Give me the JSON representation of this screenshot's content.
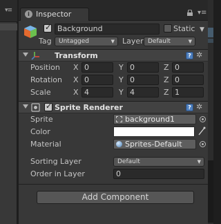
{
  "inspector": {
    "tab_label": "Inspector",
    "icons": [
      "info-icon",
      "lock-icon",
      "menu-icon"
    ]
  },
  "gameobject": {
    "active": true,
    "name": "Background",
    "static_label": "Static",
    "static_checked": false,
    "tag_label": "Tag",
    "tag_value": "Untagged",
    "layer_label": "Layer",
    "layer_value": "Default"
  },
  "transform": {
    "title": "Transform",
    "rows": [
      {
        "label": "Position",
        "x": "0",
        "y": "0",
        "z": "0"
      },
      {
        "label": "Rotation",
        "x": "0",
        "y": "0",
        "z": "0"
      },
      {
        "label": "Scale",
        "x": "4",
        "y": "4",
        "z": "1"
      }
    ],
    "axis_labels": {
      "x": "X",
      "y": "Y",
      "z": "Z"
    }
  },
  "sprite_renderer": {
    "title": "Sprite Renderer",
    "enabled": true,
    "sprite_label": "Sprite",
    "sprite_value": "background1",
    "color_label": "Color",
    "color_value": "#ffffff",
    "material_label": "Material",
    "material_value": "Sprites-Default",
    "sorting_layer_label": "Sorting Layer",
    "sorting_layer_value": "Default",
    "order_label": "Order in Layer",
    "order_value": "0"
  },
  "add_component": {
    "label": "Add Component"
  },
  "colors": {
    "panel_bg": "#383838",
    "header_bg": "#424242",
    "field_bg": "#2a2a2a",
    "help_blue": "#4d7fbf"
  }
}
